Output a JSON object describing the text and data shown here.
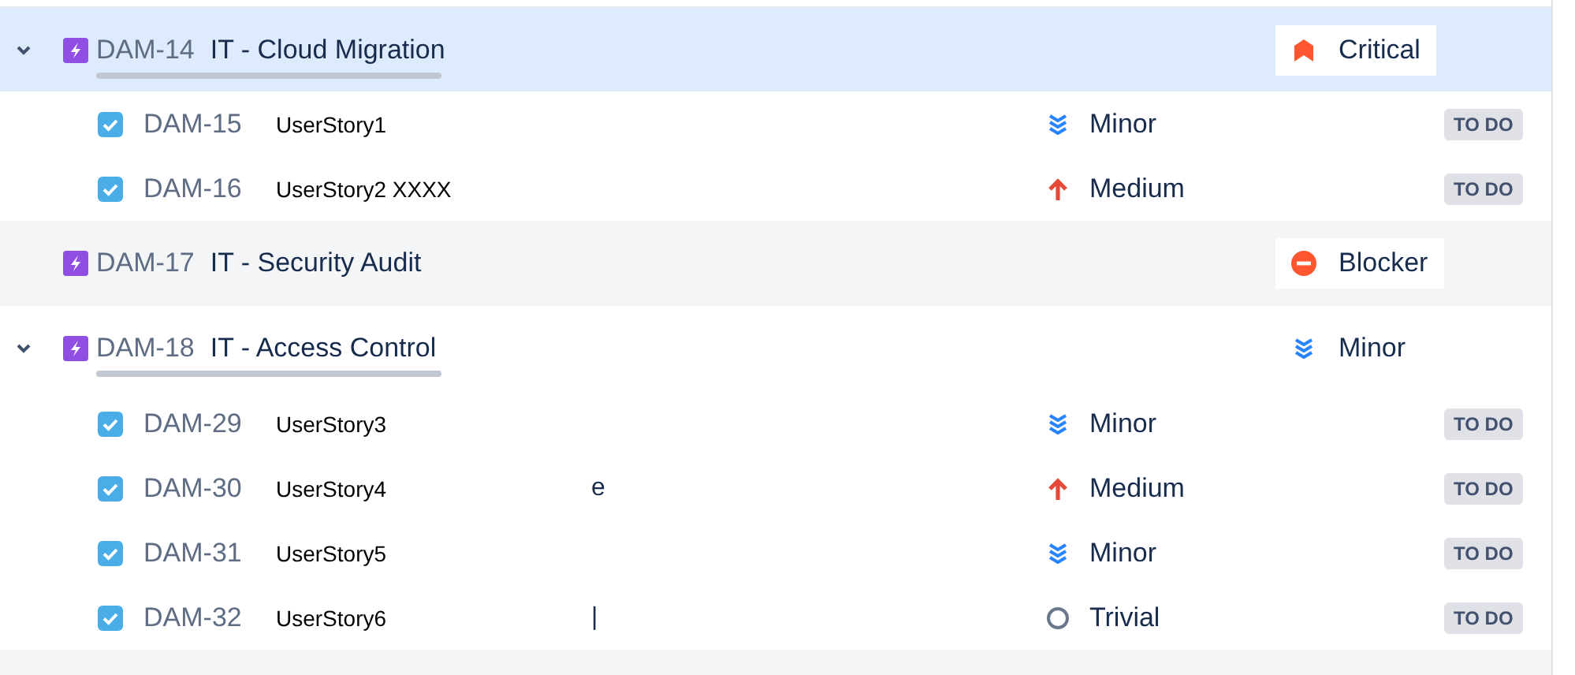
{
  "rows": [
    {
      "kind": "epic",
      "key": "DAM-14",
      "summary": "IT - Cloud Migration",
      "expanded": true,
      "selected": true,
      "priority": {
        "label": "Critical",
        "kind": "critical"
      }
    },
    {
      "kind": "story",
      "key": "DAM-15",
      "summary": "UserStory1",
      "checked": true,
      "priority": {
        "label": "Minor",
        "kind": "minor"
      },
      "status": "TO DO"
    },
    {
      "kind": "story",
      "key": "DAM-16",
      "summary": "UserStory2 XXXX",
      "checked": true,
      "priority": {
        "label": "Medium",
        "kind": "medium"
      },
      "status": "TO DO"
    },
    {
      "kind": "epic",
      "key": "DAM-17",
      "summary": "IT - Security Audit",
      "expanded": false,
      "selected": false,
      "priority": {
        "label": "Blocker",
        "kind": "blocker"
      }
    },
    {
      "kind": "epic",
      "key": "DAM-18",
      "summary": "IT - Access Control",
      "expanded": true,
      "selected": false,
      "priority": {
        "label": "Minor",
        "kind": "minor"
      }
    },
    {
      "kind": "story",
      "key": "DAM-29",
      "summary": "UserStory3",
      "checked": true,
      "priority": {
        "label": "Minor",
        "kind": "minor"
      },
      "status": "TO DO"
    },
    {
      "kind": "story",
      "key": "DAM-30",
      "summary": "UserStory4",
      "column_3": "e",
      "checked": true,
      "priority": {
        "label": "Medium",
        "kind": "medium"
      },
      "status": "TO DO"
    },
    {
      "kind": "story",
      "key": "DAM-31",
      "summary": "UserStory5",
      "checked": true,
      "priority": {
        "label": "Minor",
        "kind": "minor"
      },
      "status": "TO DO"
    },
    {
      "kind": "story",
      "key": "DAM-32",
      "summary": "UserStory6",
      "column_3": "|",
      "checked": true,
      "priority": {
        "label": "Trivial",
        "kind": "trivial"
      },
      "status": "TO DO"
    }
  ]
}
